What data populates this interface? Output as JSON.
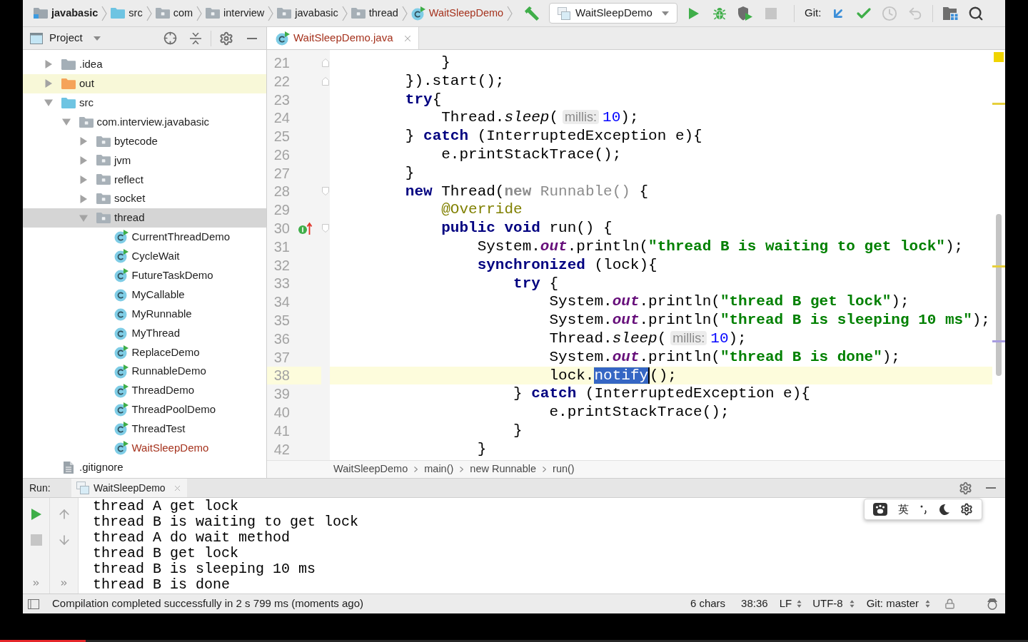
{
  "navigation_bar": {
    "breadcrumbs": [
      {
        "kind": "module",
        "label": "javabasic"
      },
      {
        "kind": "source_root",
        "label": "src"
      },
      {
        "kind": "package",
        "label": "com"
      },
      {
        "kind": "package",
        "label": "interview"
      },
      {
        "kind": "package",
        "label": "javabasic"
      },
      {
        "kind": "package",
        "label": "thread"
      },
      {
        "kind": "class",
        "label": "WaitSleepDemo"
      }
    ],
    "build_actions": [
      {
        "kind": "build",
        "disabled": false
      }
    ],
    "run_configuration": {
      "label": "WaitSleepDemo"
    },
    "run_actions": [
      {
        "kind": "run",
        "disabled": false
      },
      {
        "kind": "debug",
        "disabled": false
      },
      {
        "kind": "coverage",
        "disabled": false
      },
      {
        "kind": "stop",
        "disabled": true
      }
    ],
    "git_label": "Git:",
    "git_actions": [
      {
        "kind": "update",
        "disabled": false
      },
      {
        "kind": "commit",
        "disabled": false
      },
      {
        "kind": "history",
        "disabled": true
      },
      {
        "kind": "rollback",
        "disabled": true
      }
    ],
    "tools": [
      {
        "kind": "project_structure"
      },
      {
        "kind": "search"
      }
    ]
  },
  "project_panel": {
    "title": "Project",
    "tree": [
      {
        "kind": "folder",
        "label": ".idea",
        "expanded": false,
        "selected": false
      },
      {
        "kind": "excluded_folder",
        "label": "out",
        "expanded": false,
        "selected": false
      },
      {
        "kind": "source_folder",
        "label": "src",
        "expanded": true,
        "selected": false,
        "children": [
          {
            "kind": "package",
            "label": "com.interview.javabasic",
            "expanded": true,
            "selected": false,
            "children": [
              {
                "kind": "package",
                "label": "bytecode",
                "expanded": false,
                "selected": false
              },
              {
                "kind": "package",
                "label": "jvm",
                "expanded": false,
                "selected": false
              },
              {
                "kind": "package",
                "label": "reflect",
                "expanded": false,
                "selected": false
              },
              {
                "kind": "package",
                "label": "socket",
                "expanded": false,
                "selected": false
              },
              {
                "kind": "package",
                "label": "thread",
                "expanded": true,
                "selected": true,
                "children": [
                  {
                    "kind": "class",
                    "label": "CurrentThreadDemo",
                    "runnable": true,
                    "unversioned": false,
                    "selected": false
                  },
                  {
                    "kind": "class",
                    "label": "CycleWait",
                    "runnable": true,
                    "unversioned": false,
                    "selected": false
                  },
                  {
                    "kind": "class",
                    "label": "FutureTaskDemo",
                    "runnable": true,
                    "unversioned": false,
                    "selected": false
                  },
                  {
                    "kind": "class",
                    "label": "MyCallable",
                    "runnable": false,
                    "unversioned": false,
                    "selected": false
                  },
                  {
                    "kind": "class",
                    "label": "MyRunnable",
                    "runnable": false,
                    "unversioned": false,
                    "selected": false
                  },
                  {
                    "kind": "class",
                    "label": "MyThread",
                    "runnable": false,
                    "unversioned": false,
                    "selected": false
                  },
                  {
                    "kind": "class",
                    "label": "ReplaceDemo",
                    "runnable": true,
                    "unversioned": false,
                    "selected": false
                  },
                  {
                    "kind": "class",
                    "label": "RunnableDemo",
                    "runnable": true,
                    "unversioned": false,
                    "selected": false
                  },
                  {
                    "kind": "class",
                    "label": "ThreadDemo",
                    "runnable": true,
                    "unversioned": false,
                    "selected": false
                  },
                  {
                    "kind": "class",
                    "label": "ThreadPoolDemo",
                    "runnable": true,
                    "unversioned": false,
                    "selected": false
                  },
                  {
                    "kind": "class",
                    "label": "ThreadTest",
                    "runnable": true,
                    "unversioned": false,
                    "selected": false
                  },
                  {
                    "kind": "class",
                    "label": "WaitSleepDemo",
                    "runnable": true,
                    "unversioned": true,
                    "selected": false
                  }
                ]
              }
            ]
          }
        ]
      },
      {
        "kind": "file",
        "label": ".gitignore",
        "selected": false
      }
    ]
  },
  "editor": {
    "tabs": [
      {
        "label": "WaitSleepDemo.java",
        "selected": true,
        "unversioned": true
      }
    ],
    "lines": [
      {
        "number": "21",
        "current": false,
        "gutter": [
          {
            "kind": "fold_end"
          }
        ],
        "tokens": [
          {
            "kind": "plain",
            "text": "            }"
          }
        ]
      },
      {
        "number": "22",
        "current": false,
        "gutter": [
          {
            "kind": "fold_end"
          }
        ],
        "tokens": [
          {
            "kind": "plain",
            "text": "        }).start();"
          }
        ]
      },
      {
        "number": "23",
        "current": false,
        "tokens": [
          {
            "kind": "keyword",
            "text": "        try"
          },
          {
            "kind": "plain",
            "text": "{"
          }
        ]
      },
      {
        "number": "24",
        "current": false,
        "tokens": [
          {
            "kind": "plain",
            "text": "            Thread."
          },
          {
            "kind": "static_method",
            "text": "sleep"
          },
          {
            "kind": "plain",
            "text": "("
          },
          {
            "kind": "hint",
            "text": "millis:"
          },
          {
            "kind": "number",
            "text": "10"
          },
          {
            "kind": "plain",
            "text": ");"
          }
        ]
      },
      {
        "number": "25",
        "current": false,
        "tokens": [
          {
            "kind": "plain",
            "text": "        } "
          },
          {
            "kind": "keyword",
            "text": "catch"
          },
          {
            "kind": "plain",
            "text": " (InterruptedException e){"
          }
        ]
      },
      {
        "number": "26",
        "current": false,
        "tokens": [
          {
            "kind": "plain",
            "text": "            e.printStackTrace();"
          }
        ]
      },
      {
        "number": "27",
        "current": false,
        "tokens": [
          {
            "kind": "plain",
            "text": "        }"
          }
        ]
      },
      {
        "number": "28",
        "current": false,
        "gutter": [
          {
            "kind": "fold_start"
          }
        ],
        "tokens": [
          {
            "kind": "keyword",
            "text": "        new"
          },
          {
            "kind": "plain",
            "text": " Thread("
          },
          {
            "kind": "anonymous_keyword",
            "text": "new"
          },
          {
            "kind": "anonymous",
            "text": " Runnable()"
          },
          {
            "kind": "plain",
            "text": " {"
          }
        ]
      },
      {
        "number": "29",
        "current": false,
        "tokens": [
          {
            "kind": "annotation",
            "text": "            @Override"
          }
        ]
      },
      {
        "number": "30",
        "current": false,
        "gutter": [
          {
            "kind": "implements"
          },
          {
            "kind": "fold_start"
          }
        ],
        "tokens": [
          {
            "kind": "keyword",
            "text": "            public"
          },
          {
            "kind": "keyword",
            "text": " void"
          },
          {
            "kind": "plain",
            "text": " run() {"
          }
        ]
      },
      {
        "number": "31",
        "current": false,
        "tokens": [
          {
            "kind": "plain",
            "text": "                System."
          },
          {
            "kind": "static_field",
            "text": "out"
          },
          {
            "kind": "plain",
            "text": ".println("
          },
          {
            "kind": "string",
            "text": "\"thread B is waiting to get lock\""
          },
          {
            "kind": "plain",
            "text": ");"
          }
        ]
      },
      {
        "number": "32",
        "current": false,
        "tokens": [
          {
            "kind": "keyword",
            "text": "                synchronized"
          },
          {
            "kind": "plain",
            "text": " (lock){"
          }
        ]
      },
      {
        "number": "33",
        "current": false,
        "tokens": [
          {
            "kind": "keyword",
            "text": "                    try"
          },
          {
            "kind": "plain",
            "text": " {"
          }
        ]
      },
      {
        "number": "34",
        "current": false,
        "tokens": [
          {
            "kind": "plain",
            "text": "                        System."
          },
          {
            "kind": "static_field",
            "text": "out"
          },
          {
            "kind": "plain",
            "text": ".println("
          },
          {
            "kind": "string",
            "text": "\"thread B get lock\""
          },
          {
            "kind": "plain",
            "text": ");"
          }
        ]
      },
      {
        "number": "35",
        "current": false,
        "tokens": [
          {
            "kind": "plain",
            "text": "                        System."
          },
          {
            "kind": "static_field",
            "text": "out"
          },
          {
            "kind": "plain",
            "text": ".println("
          },
          {
            "kind": "string",
            "text": "\"thread B is sleeping 10 ms\""
          },
          {
            "kind": "plain",
            "text": ");"
          }
        ]
      },
      {
        "number": "36",
        "current": false,
        "tokens": [
          {
            "kind": "plain",
            "text": "                        Thread."
          },
          {
            "kind": "static_method",
            "text": "sleep"
          },
          {
            "kind": "plain",
            "text": "("
          },
          {
            "kind": "hint",
            "text": "millis:"
          },
          {
            "kind": "number",
            "text": "10"
          },
          {
            "kind": "plain",
            "text": ");"
          }
        ]
      },
      {
        "number": "37",
        "current": false,
        "tokens": [
          {
            "kind": "plain",
            "text": "                        System."
          },
          {
            "kind": "static_field",
            "text": "out"
          },
          {
            "kind": "plain",
            "text": ".println("
          },
          {
            "kind": "string",
            "text": "\"thread B is done\""
          },
          {
            "kind": "plain",
            "text": ");"
          }
        ]
      },
      {
        "number": "38",
        "current": true,
        "tokens": [
          {
            "kind": "plain",
            "text": "                        lock."
          },
          {
            "kind": "selection",
            "text": "notify"
          },
          {
            "kind": "plain",
            "text": "();"
          }
        ]
      },
      {
        "number": "39",
        "current": false,
        "tokens": [
          {
            "kind": "plain",
            "text": "                    } "
          },
          {
            "kind": "keyword",
            "text": "catch"
          },
          {
            "kind": "plain",
            "text": " (InterruptedException e){"
          }
        ]
      },
      {
        "number": "40",
        "current": false,
        "tokens": [
          {
            "kind": "plain",
            "text": "                        e.printStackTrace();"
          }
        ]
      },
      {
        "number": "41",
        "current": false,
        "tokens": [
          {
            "kind": "plain",
            "text": "                    }"
          }
        ]
      },
      {
        "number": "42",
        "current": false,
        "tokens": [
          {
            "kind": "plain",
            "text": "                }"
          }
        ]
      }
    ],
    "breadcrumbs": [
      "WaitSleepDemo",
      "main()",
      "new Runnable",
      "run()"
    ]
  },
  "run_panel": {
    "label": "Run:",
    "tabs": [
      {
        "label": "WaitSleepDemo",
        "selected": true
      }
    ],
    "actions": [
      {
        "kind": "rerun",
        "disabled": false
      },
      {
        "kind": "stop",
        "disabled": true
      },
      {
        "kind": "more"
      }
    ],
    "navigation": [
      {
        "kind": "up"
      },
      {
        "kind": "down"
      },
      {
        "kind": "more"
      }
    ],
    "output": [
      "thread A get lock",
      "thread B is waiting to get lock",
      "thread A do wait method",
      "thread B get lock",
      "thread B is sleeping 10 ms",
      "thread B is done"
    ]
  },
  "ime_toolbar": {
    "language": "英"
  },
  "status_bar": {
    "message": "Compilation completed successfully in 2 s 799 ms (moments ago)",
    "selection": "6 chars",
    "position": "38:36",
    "line_separator": "LF",
    "encoding": "UTF-8",
    "vcs_branch": "Git: master"
  },
  "video_progress": {
    "level": 0.083
  }
}
